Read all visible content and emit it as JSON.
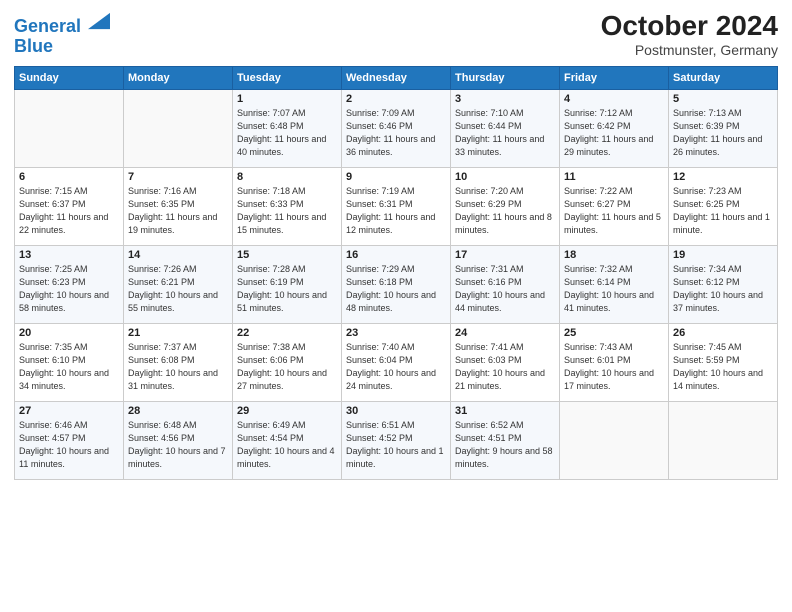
{
  "header": {
    "logo_line1": "General",
    "logo_line2": "Blue",
    "month": "October 2024",
    "location": "Postmunster, Germany"
  },
  "days_of_week": [
    "Sunday",
    "Monday",
    "Tuesday",
    "Wednesday",
    "Thursday",
    "Friday",
    "Saturday"
  ],
  "weeks": [
    [
      {
        "num": "",
        "info": ""
      },
      {
        "num": "",
        "info": ""
      },
      {
        "num": "1",
        "info": "Sunrise: 7:07 AM\nSunset: 6:48 PM\nDaylight: 11 hours and 40 minutes."
      },
      {
        "num": "2",
        "info": "Sunrise: 7:09 AM\nSunset: 6:46 PM\nDaylight: 11 hours and 36 minutes."
      },
      {
        "num": "3",
        "info": "Sunrise: 7:10 AM\nSunset: 6:44 PM\nDaylight: 11 hours and 33 minutes."
      },
      {
        "num": "4",
        "info": "Sunrise: 7:12 AM\nSunset: 6:42 PM\nDaylight: 11 hours and 29 minutes."
      },
      {
        "num": "5",
        "info": "Sunrise: 7:13 AM\nSunset: 6:39 PM\nDaylight: 11 hours and 26 minutes."
      }
    ],
    [
      {
        "num": "6",
        "info": "Sunrise: 7:15 AM\nSunset: 6:37 PM\nDaylight: 11 hours and 22 minutes."
      },
      {
        "num": "7",
        "info": "Sunrise: 7:16 AM\nSunset: 6:35 PM\nDaylight: 11 hours and 19 minutes."
      },
      {
        "num": "8",
        "info": "Sunrise: 7:18 AM\nSunset: 6:33 PM\nDaylight: 11 hours and 15 minutes."
      },
      {
        "num": "9",
        "info": "Sunrise: 7:19 AM\nSunset: 6:31 PM\nDaylight: 11 hours and 12 minutes."
      },
      {
        "num": "10",
        "info": "Sunrise: 7:20 AM\nSunset: 6:29 PM\nDaylight: 11 hours and 8 minutes."
      },
      {
        "num": "11",
        "info": "Sunrise: 7:22 AM\nSunset: 6:27 PM\nDaylight: 11 hours and 5 minutes."
      },
      {
        "num": "12",
        "info": "Sunrise: 7:23 AM\nSunset: 6:25 PM\nDaylight: 11 hours and 1 minute."
      }
    ],
    [
      {
        "num": "13",
        "info": "Sunrise: 7:25 AM\nSunset: 6:23 PM\nDaylight: 10 hours and 58 minutes."
      },
      {
        "num": "14",
        "info": "Sunrise: 7:26 AM\nSunset: 6:21 PM\nDaylight: 10 hours and 55 minutes."
      },
      {
        "num": "15",
        "info": "Sunrise: 7:28 AM\nSunset: 6:19 PM\nDaylight: 10 hours and 51 minutes."
      },
      {
        "num": "16",
        "info": "Sunrise: 7:29 AM\nSunset: 6:18 PM\nDaylight: 10 hours and 48 minutes."
      },
      {
        "num": "17",
        "info": "Sunrise: 7:31 AM\nSunset: 6:16 PM\nDaylight: 10 hours and 44 minutes."
      },
      {
        "num": "18",
        "info": "Sunrise: 7:32 AM\nSunset: 6:14 PM\nDaylight: 10 hours and 41 minutes."
      },
      {
        "num": "19",
        "info": "Sunrise: 7:34 AM\nSunset: 6:12 PM\nDaylight: 10 hours and 37 minutes."
      }
    ],
    [
      {
        "num": "20",
        "info": "Sunrise: 7:35 AM\nSunset: 6:10 PM\nDaylight: 10 hours and 34 minutes."
      },
      {
        "num": "21",
        "info": "Sunrise: 7:37 AM\nSunset: 6:08 PM\nDaylight: 10 hours and 31 minutes."
      },
      {
        "num": "22",
        "info": "Sunrise: 7:38 AM\nSunset: 6:06 PM\nDaylight: 10 hours and 27 minutes."
      },
      {
        "num": "23",
        "info": "Sunrise: 7:40 AM\nSunset: 6:04 PM\nDaylight: 10 hours and 24 minutes."
      },
      {
        "num": "24",
        "info": "Sunrise: 7:41 AM\nSunset: 6:03 PM\nDaylight: 10 hours and 21 minutes."
      },
      {
        "num": "25",
        "info": "Sunrise: 7:43 AM\nSunset: 6:01 PM\nDaylight: 10 hours and 17 minutes."
      },
      {
        "num": "26",
        "info": "Sunrise: 7:45 AM\nSunset: 5:59 PM\nDaylight: 10 hours and 14 minutes."
      }
    ],
    [
      {
        "num": "27",
        "info": "Sunrise: 6:46 AM\nSunset: 4:57 PM\nDaylight: 10 hours and 11 minutes."
      },
      {
        "num": "28",
        "info": "Sunrise: 6:48 AM\nSunset: 4:56 PM\nDaylight: 10 hours and 7 minutes."
      },
      {
        "num": "29",
        "info": "Sunrise: 6:49 AM\nSunset: 4:54 PM\nDaylight: 10 hours and 4 minutes."
      },
      {
        "num": "30",
        "info": "Sunrise: 6:51 AM\nSunset: 4:52 PM\nDaylight: 10 hours and 1 minute."
      },
      {
        "num": "31",
        "info": "Sunrise: 6:52 AM\nSunset: 4:51 PM\nDaylight: 9 hours and 58 minutes."
      },
      {
        "num": "",
        "info": ""
      },
      {
        "num": "",
        "info": ""
      }
    ]
  ]
}
